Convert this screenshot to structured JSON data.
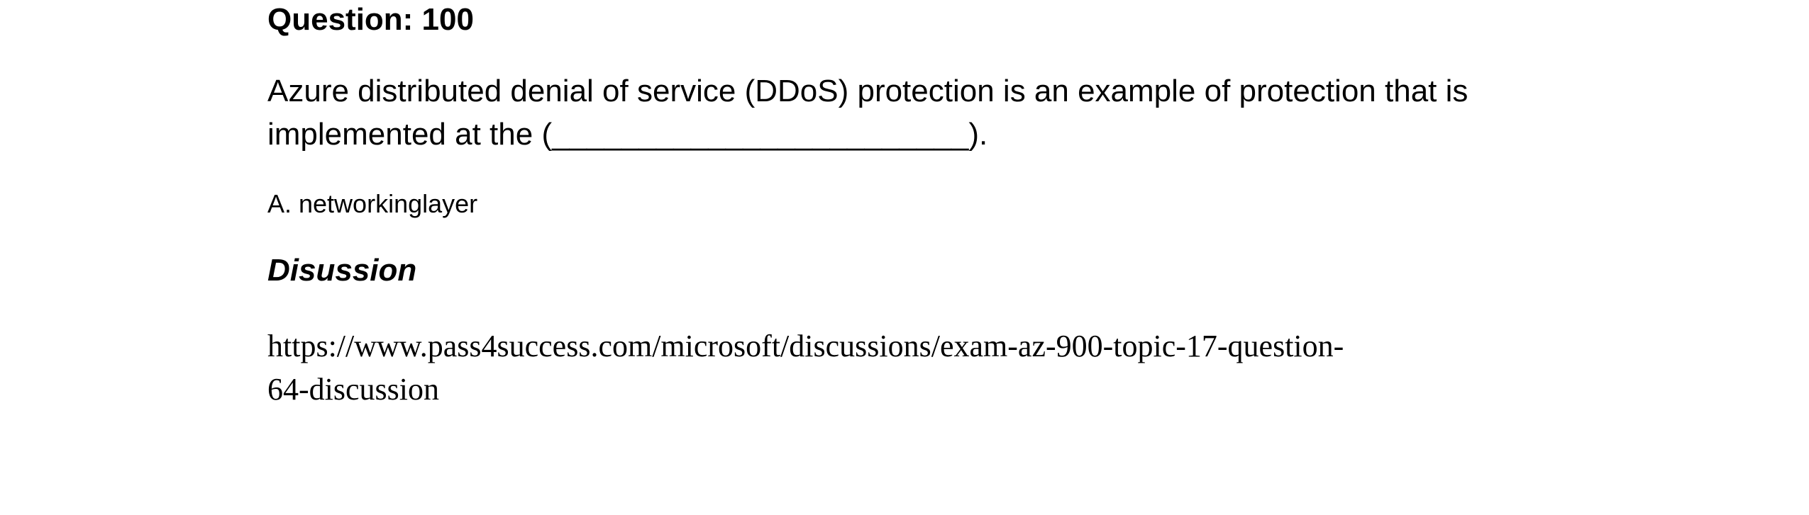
{
  "question": {
    "title": "Question: 100",
    "body_line1": "Azure distributed denial of service (DDoS) protection is an example of protection that is",
    "body_line2": "implemented at the (________________________)."
  },
  "answer": {
    "text": "A. networkinglayer"
  },
  "discussion": {
    "heading": "Disussion",
    "link_line1": "https://www.pass4success.com/microsoft/discussions/exam-az-900-topic-17-question-",
    "link_line2": "64-discussion"
  }
}
